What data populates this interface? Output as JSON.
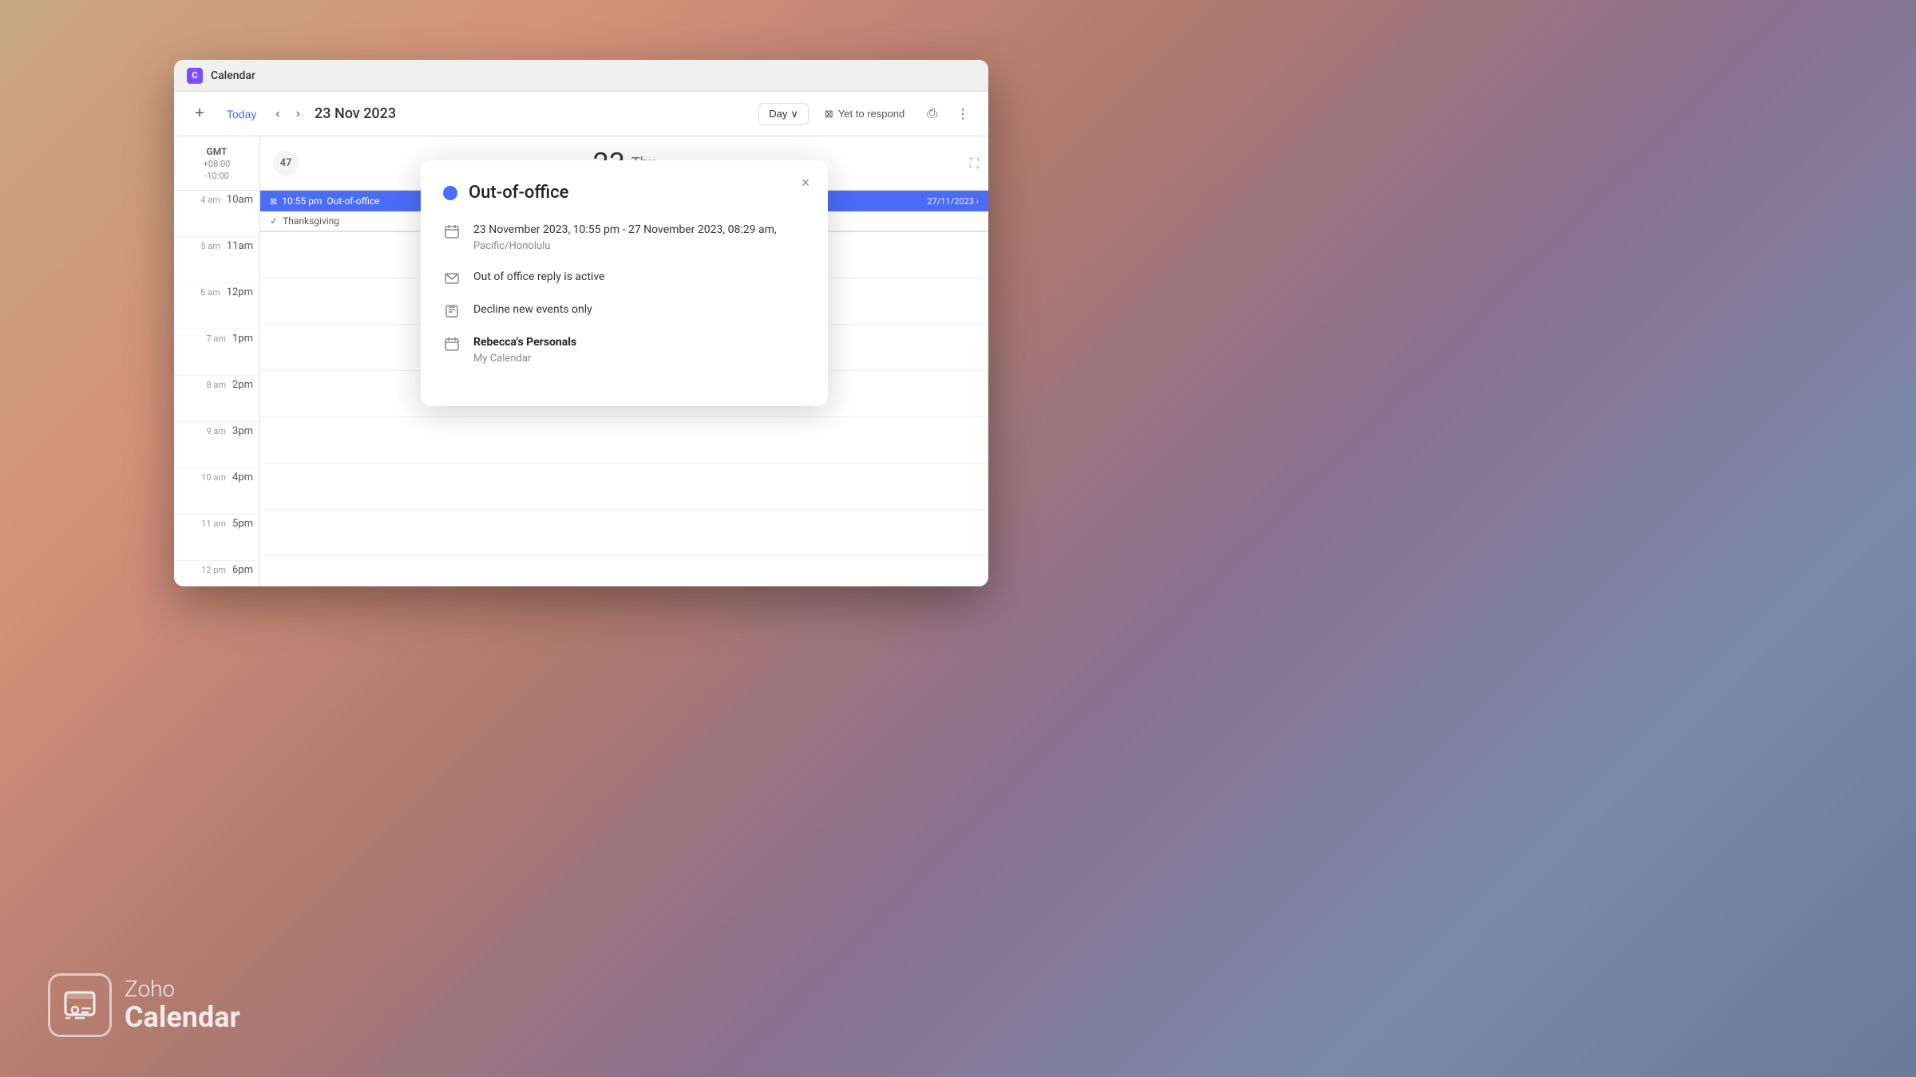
{
  "app": {
    "title": "Calendar",
    "icon_letter": "C",
    "accent_color": "#7c4dff"
  },
  "toolbar": {
    "add_label": "+",
    "today_label": "Today",
    "nav_prev": "‹",
    "nav_next": "›",
    "current_date": "23 Nov 2023",
    "view_mode": "Day",
    "view_mode_arrow": "∨",
    "yet_to_respond_label": "Yet to respond",
    "yet_to_respond_icon": "⊠",
    "print_icon": "⎙",
    "more_icon": "⋮"
  },
  "gmt": {
    "label": "GMT",
    "offset1": "+08:00",
    "offset2": "-10:00"
  },
  "day_header": {
    "week_number": "47",
    "day_number": "23",
    "day_name": "Thu",
    "expand_icon": "⛶"
  },
  "time_slots": [
    {
      "gmt": "4 am",
      "local": "10am"
    },
    {
      "gmt": "5 am",
      "local": "11am"
    },
    {
      "gmt": "6 am",
      "local": "12pm"
    },
    {
      "gmt": "7 am",
      "local": "1pm"
    },
    {
      "gmt": "8 am",
      "local": "2pm"
    },
    {
      "gmt": "9 am",
      "local": "3pm"
    },
    {
      "gmt": "10 am",
      "local": "4pm"
    },
    {
      "gmt": "11 am",
      "local": "5pm"
    },
    {
      "gmt": "12 pm",
      "local": "6pm"
    }
  ],
  "allday_events": {
    "oof": {
      "time": "10:55 pm",
      "icon": "⊠",
      "label": "Out-of-office",
      "date": "27/11/2023 ›"
    },
    "thanksgiving": {
      "check": "✓",
      "label": "Thanksgiving"
    }
  },
  "popup": {
    "title": "Out-of-office",
    "dot_color": "#4a6cf7",
    "close_label": "×",
    "date_range": "23 November 2023,  10:55 pm  -  27 November 2023,  08:29 am,",
    "timezone": "Pacific/Honolulu",
    "oof_reply": "Out of office reply is active",
    "decline_rule": "Decline new events only",
    "calendar_name": "Rebecca's Personals",
    "calendar_sub": "My Calendar",
    "date_icon": "📅",
    "mail_icon": "✉",
    "decline_icon": "📋",
    "cal_icon": "📅"
  },
  "watermark": {
    "label_top": "Zoho",
    "label_bottom": "Calendar"
  }
}
